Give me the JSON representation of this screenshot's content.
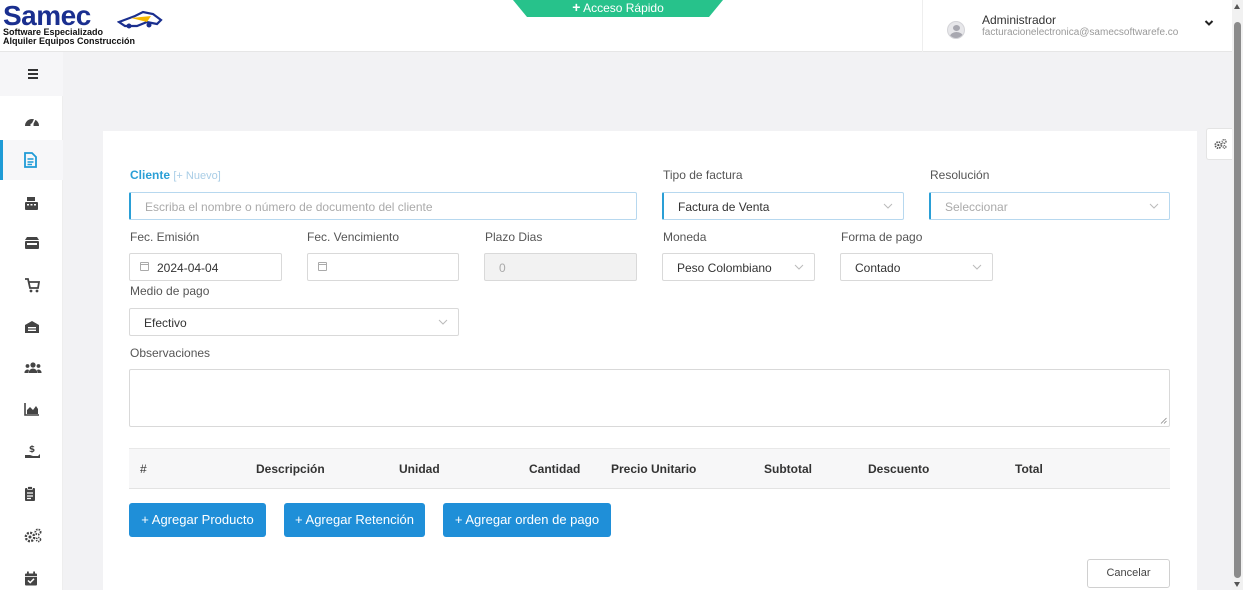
{
  "header": {
    "logo": {
      "brand": "Samec",
      "subtitle_line1": "Software Especializado",
      "subtitle_line2": "Alquiler Equipos Construcción"
    },
    "quick_access": {
      "icon": "+",
      "label": "Acceso Rápido"
    },
    "user": {
      "name": "Administrador",
      "email": "facturacionelectronica@samecsoftwarefe.co"
    }
  },
  "sidebar": {
    "items": [
      {
        "icon": "dashboard-icon",
        "active": false
      },
      {
        "icon": "invoice-document-icon",
        "active": true
      },
      {
        "icon": "cash-register-icon",
        "active": false
      },
      {
        "icon": "store-icon",
        "active": false
      },
      {
        "icon": "cart-icon",
        "active": false
      },
      {
        "icon": "warehouse-icon",
        "active": false
      },
      {
        "icon": "users-icon",
        "active": false
      },
      {
        "icon": "area-chart-icon",
        "active": false
      },
      {
        "icon": "hand-dollar-icon",
        "active": false
      },
      {
        "icon": "clipboard-icon",
        "active": false
      },
      {
        "icon": "cogs-icon",
        "active": false
      },
      {
        "icon": "calendar-check-icon",
        "active": false
      }
    ]
  },
  "form": {
    "cliente": {
      "label": "Cliente",
      "new_link": "[+ Nuevo]",
      "placeholder": "Escriba el nombre o número de documento del cliente"
    },
    "tipo_factura": {
      "label": "Tipo de factura",
      "value": "Factura de Venta"
    },
    "resolucion": {
      "label": "Resolución",
      "placeholder": "Seleccionar"
    },
    "fec_emision": {
      "label": "Fec. Emisión",
      "value": "2024-04-04"
    },
    "fec_vencimiento": {
      "label": "Fec. Vencimiento",
      "value": ""
    },
    "plazo_dias": {
      "label": "Plazo Dias",
      "value": "0"
    },
    "moneda": {
      "label": "Moneda",
      "value": "Peso Colombiano"
    },
    "forma_pago": {
      "label": "Forma de pago",
      "value": "Contado"
    },
    "medio_pago": {
      "label": "Medio de pago",
      "value": "Efectivo"
    },
    "observaciones": {
      "label": "Observaciones",
      "value": ""
    }
  },
  "table": {
    "columns": [
      "#",
      "Descripción",
      "Unidad",
      "Cantidad",
      "Precio Unitario",
      "Subtotal",
      "Descuento",
      "Total"
    ],
    "rows": []
  },
  "actions": {
    "add_product": "+ Agregar Producto",
    "add_retention": "+ Agregar Retención",
    "add_payment_order": "+ Agregar orden de pago",
    "cancel": "Cancelar"
  },
  "colors": {
    "brand_blue": "#1a2f8f",
    "accent": "#1f8fd8",
    "quick_access_green": "#27c28b",
    "active_indicator": "#1f9bd6"
  }
}
